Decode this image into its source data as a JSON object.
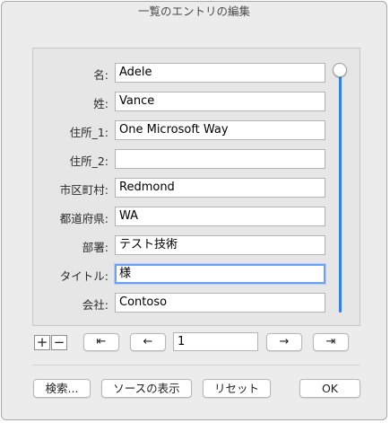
{
  "window": {
    "title": "一覧のエントリの編集"
  },
  "fields": [
    {
      "label": "名:",
      "value": "Adele"
    },
    {
      "label": "姓:",
      "value": "Vance"
    },
    {
      "label": "住所_1:",
      "value": "One Microsoft Way"
    },
    {
      "label": "住所_2:",
      "value": ""
    },
    {
      "label": "市区町村:",
      "value": "Redmond"
    },
    {
      "label": "都道府県:",
      "value": "WA"
    },
    {
      "label": "部署:",
      "value": "テスト技術"
    },
    {
      "label": "タイトル:",
      "value": "様"
    },
    {
      "label": "会社:",
      "value": "Contoso"
    }
  ],
  "navigation": {
    "add": "+",
    "remove": "−",
    "first": "⇤",
    "prev": "←",
    "record": "1",
    "next": "→",
    "last": "⇥"
  },
  "buttons": {
    "search": "検索...",
    "show_source": "ソースの表示",
    "reset": "リセット",
    "ok": "OK"
  },
  "colors": {
    "accent": "#2f7fe6",
    "focus_ring": "#6ba0f5"
  }
}
